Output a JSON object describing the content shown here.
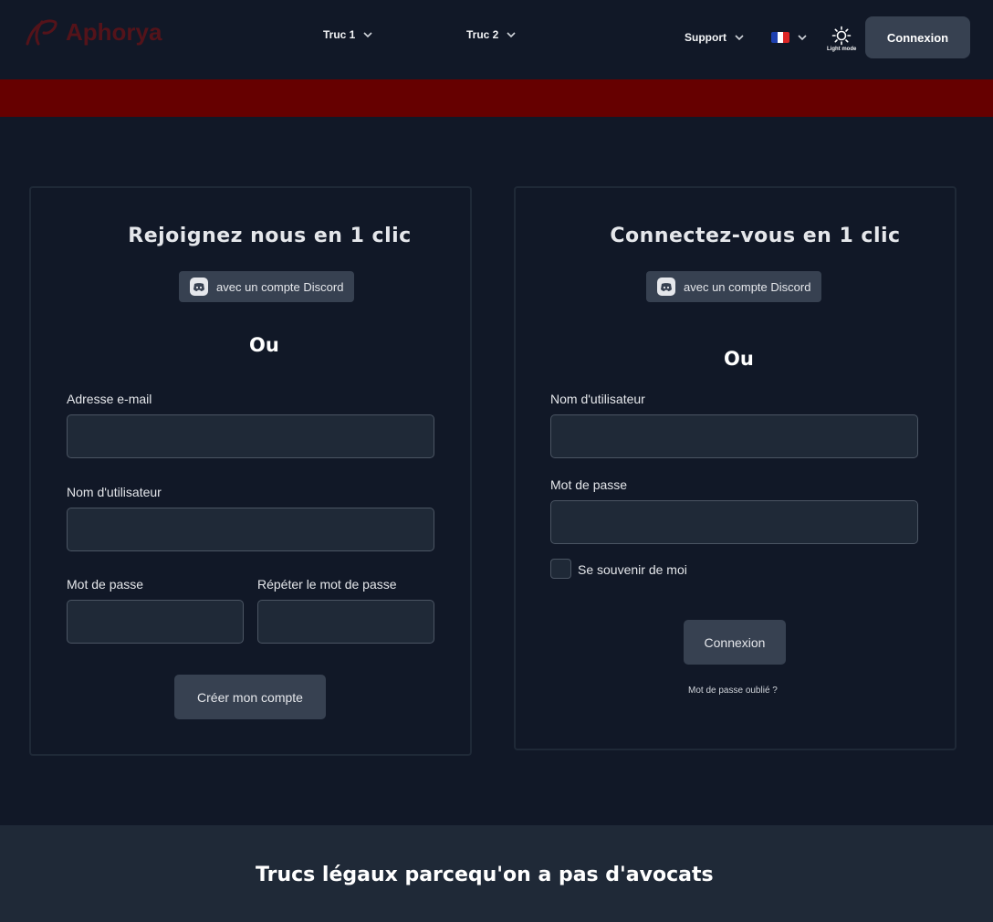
{
  "header": {
    "brand": "Aphorya",
    "nav": [
      {
        "label": "Truc 1"
      },
      {
        "label": "Truc 2"
      }
    ],
    "support": "Support",
    "language": "FR",
    "theme_toggle_label": "Light mode",
    "login_button": "Connexion"
  },
  "colors": {
    "background": "#111827",
    "card_border": "#1f2937",
    "input_bg": "#1f2937",
    "button_bg": "#374151",
    "banner": "#660000",
    "brand": "#8b1010"
  },
  "signup": {
    "title": "Rejoignez nous en 1 clic",
    "discord_button": "avec un compte Discord",
    "or": "Ou",
    "email_label": "Adresse e-mail",
    "email_value": "",
    "username_label": "Nom d'utilisateur",
    "username_value": "",
    "password_label": "Mot de passe",
    "password_value": "",
    "repeat_password_label": "Répéter le mot de passe",
    "repeat_password_value": "",
    "submit_button": "Créer mon compte"
  },
  "login": {
    "title": "Connectez-vous en 1 clic",
    "discord_button": "avec un compte Discord",
    "or": "Ou",
    "username_label": "Nom d'utilisateur",
    "username_value": "",
    "password_label": "Mot de passe",
    "password_value": "",
    "remember_label": "Se souvenir de moi",
    "remember_checked": false,
    "submit_button": "Connexion",
    "forgot_link": "Mot de passe oublié ?"
  },
  "footer": {
    "title": "Trucs légaux parcequ'on a pas d'avocats"
  }
}
